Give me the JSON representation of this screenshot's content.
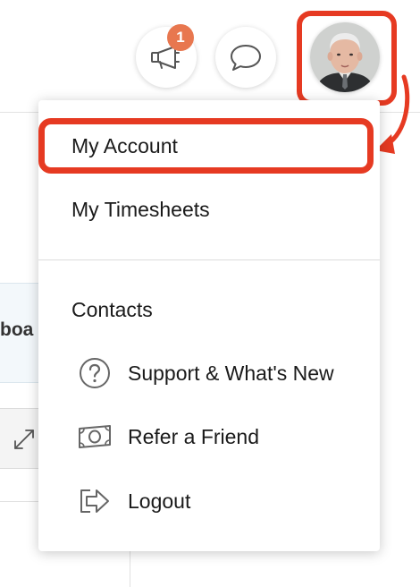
{
  "header": {
    "announcements_badge": "1"
  },
  "background": {
    "tab_fragment": "boa"
  },
  "account_menu": {
    "items": [
      {
        "label": "My Account",
        "icon": null
      },
      {
        "label": "My Timesheets",
        "icon": null
      },
      {
        "label": "Contacts",
        "icon": null
      },
      {
        "label": "Support & What's New",
        "icon": "question-circle-icon"
      },
      {
        "label": "Refer a Friend",
        "icon": "money-bill-icon"
      },
      {
        "label": "Logout",
        "icon": "logout-arrow-icon"
      }
    ]
  },
  "colors": {
    "highlight": "#e63a22",
    "badge": "#e8774f"
  }
}
